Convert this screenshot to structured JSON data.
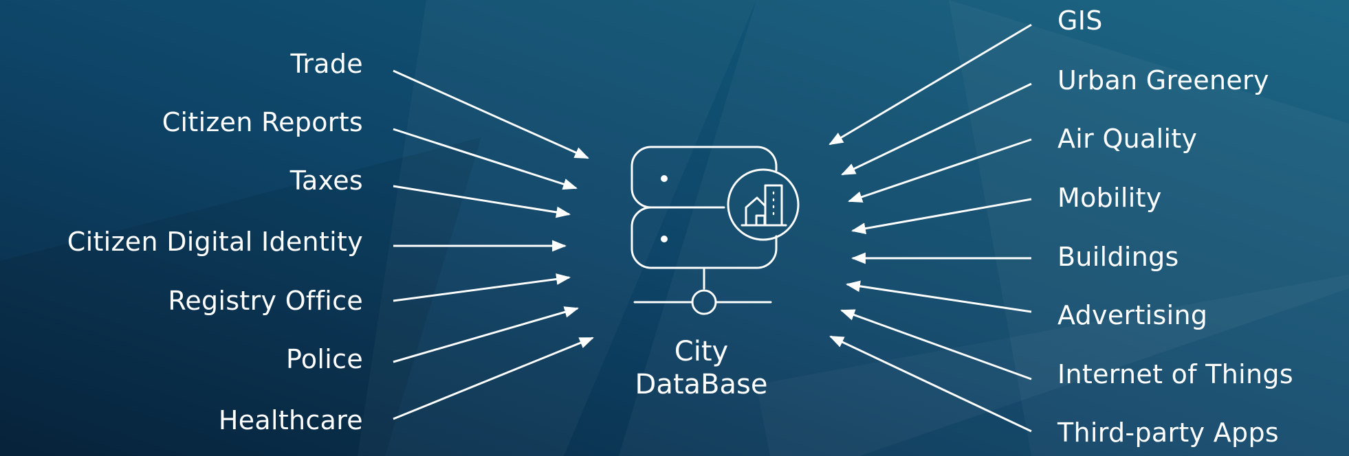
{
  "diagram": {
    "center": {
      "line1": "City",
      "line2": "DataBase",
      "icon": "server-building-icon"
    },
    "left_sources": [
      {
        "label": "Trade"
      },
      {
        "label": "Citizen Reports"
      },
      {
        "label": "Taxes"
      },
      {
        "label": "Citizen Digital Identity"
      },
      {
        "label": "Registry Office"
      },
      {
        "label": "Police"
      },
      {
        "label": "Healthcare"
      }
    ],
    "right_sources": [
      {
        "label": "GIS"
      },
      {
        "label": "Urban Greenery"
      },
      {
        "label": "Air Quality"
      },
      {
        "label": "Mobility"
      },
      {
        "label": "Buildings"
      },
      {
        "label": "Advertising"
      },
      {
        "label": "Internet of Things"
      },
      {
        "label": "Third-party Apps"
      }
    ],
    "colors": {
      "background_dark": "#0a2a45",
      "background_mid": "#0f4a6e",
      "background_light": "#1a6f8f",
      "foreground": "#ffffff"
    }
  }
}
